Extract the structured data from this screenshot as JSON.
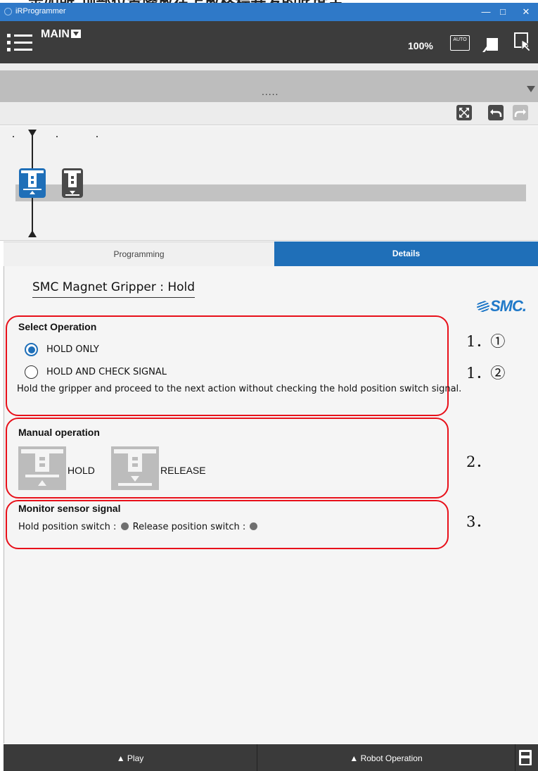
{
  "caption": "示如所,顶部位置降放在上放格程开发的此度主.",
  "window": {
    "title": "iRProgrammer",
    "minimize": "—",
    "maximize": "□",
    "close": "✕"
  },
  "toolbar": {
    "program_name": "MAIN",
    "zoom": "100%",
    "mode_icon_text": "AUTO"
  },
  "band": {
    "dots": "....."
  },
  "timeline": {
    "blocks": [
      "gripper-hold-block",
      "gripper-release-block"
    ],
    "selected_index": 0
  },
  "tabs": {
    "programming": "Programming",
    "details": "Details",
    "active": "details"
  },
  "details": {
    "title": "SMC Magnet Gripper : Hold",
    "logo": "SMC.",
    "select_operation": {
      "title": "Select Operation",
      "options": [
        "HOLD ONLY",
        "HOLD AND CHECK SIGNAL"
      ],
      "selected": 0,
      "description": "Hold the gripper and proceed to the next action without checking the hold position switch signal."
    },
    "manual_operation": {
      "title": "Manual operation",
      "hold_label": "HOLD",
      "release_label": "RELEASE"
    },
    "monitor": {
      "title": "Monitor sensor signal",
      "hold_switch_label": "Hold position switch :",
      "release_switch_label": "Release position switch :",
      "hold_switch_on": false,
      "release_switch_on": false
    }
  },
  "annotations": {
    "note_1_1": "1．①",
    "note_1_2": "1．②",
    "note_2": "2．",
    "note_3": "3．"
  },
  "colors": {
    "titlebar": "#2f79c8",
    "accent": "#1f6fb8",
    "annotation": "#e8101a",
    "toolbar": "#3c3c3c"
  },
  "bottom": {
    "play": "▲ Play",
    "robot_operation": "▲ Robot Operation"
  }
}
